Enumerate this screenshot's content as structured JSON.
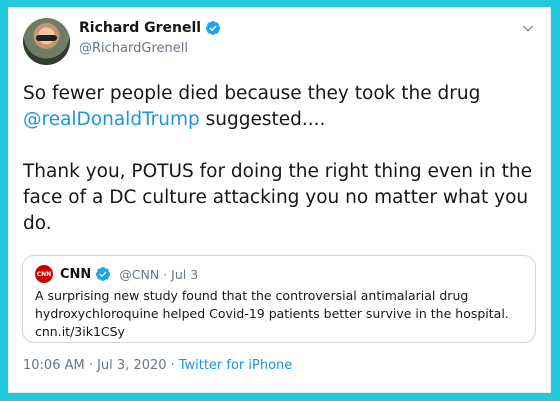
{
  "tweet": {
    "author_name": "Richard Grenell",
    "author_handle": "@RichardGrenell",
    "text_part1": "So fewer people died because they took the drug",
    "mention": "@realDonaldTrump",
    "text_part2": " suggested....\n\nThank you, POTUS for doing the right thing even in the face of a DC culture attacking you no matter what you do.",
    "time": "10:06 AM · Jul 3, 2020",
    "separator": "·",
    "source": "Twitter for iPhone"
  },
  "quote": {
    "logo_text": "CNN",
    "name": "CNN",
    "meta": "@CNN · Jul 3",
    "text": "A surprising new study found that the controversial antimalarial drug hydroxychloroquine helped Covid-19 patients better survive in the hospital. cnn.it/3ik1CSy"
  },
  "icons": {
    "verified": "verified-badge-icon",
    "chevron": "chevron-down-icon"
  },
  "colors": {
    "background": "#22c8dc",
    "link": "#1b95e0",
    "text": "#14171a",
    "secondary": "#657786",
    "cnn_red": "#cc0000"
  }
}
